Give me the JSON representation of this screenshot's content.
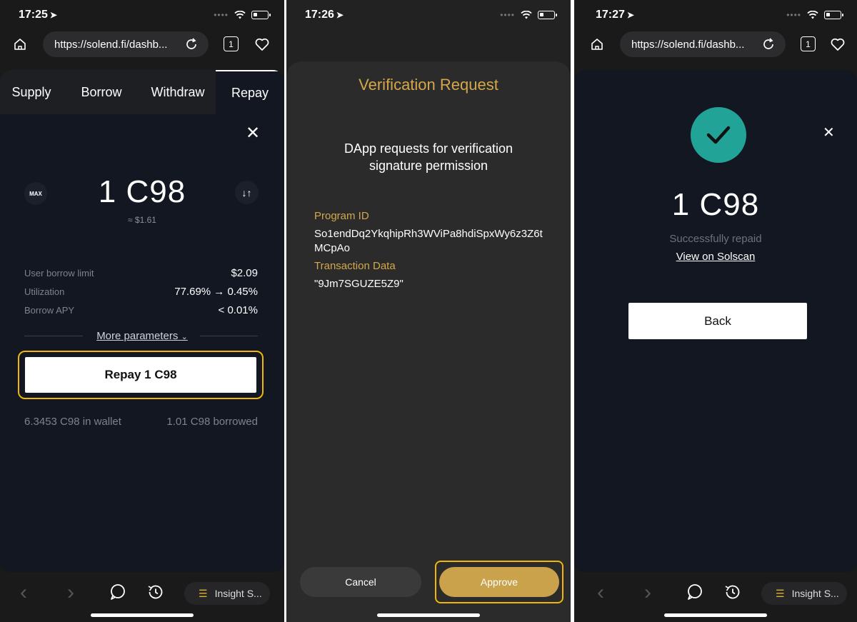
{
  "screen1": {
    "status": {
      "time": "17:25"
    },
    "browser": {
      "url": "https://solend.fi/dashb...",
      "tab_count": "1"
    },
    "tabs": [
      "Supply",
      "Borrow",
      "Withdraw",
      "Repay"
    ],
    "active_tab": "Repay",
    "max_label": "MAX",
    "amount": "1 C98",
    "usd_value": "≈ $1.61",
    "stats": [
      {
        "label": "User borrow limit",
        "value": "$2.09"
      },
      {
        "label": "Utilization",
        "value": "77.69% → 0.45%"
      },
      {
        "label": "Borrow APY",
        "value": "< 0.01%"
      }
    ],
    "more_parameters": "More parameters",
    "repay_button": "Repay 1 C98",
    "wallet_balance": "6.3453 C98 in wallet",
    "borrowed": "1.01 C98 borrowed",
    "insight_label": "Insight S..."
  },
  "screen2": {
    "status": {
      "time": "17:26"
    },
    "title": "Verification Request",
    "description": "DApp requests for verification signature permission",
    "program_id_label": "Program ID",
    "program_id_value": "So1endDq2YkqhipRh3WViPa8hdiSpxWy6z3Z6tMCpAo",
    "transaction_data_label": "Transaction Data",
    "transaction_data_value": "\"9Jm7SGUZE5Z9\"",
    "cancel_button": "Cancel",
    "approve_button": "Approve"
  },
  "screen3": {
    "status": {
      "time": "17:27"
    },
    "browser": {
      "url": "https://solend.fi/dashb...",
      "tab_count": "1"
    },
    "amount": "1 C98",
    "success_text": "Successfully repaid",
    "solscan_link": "View on Solscan",
    "back_button": "Back",
    "insight_label": "Insight S..."
  },
  "colors": {
    "highlight_border": "#f2b705",
    "gold_text": "#d4a84a",
    "approve_fill": "#caa24b",
    "success_teal": "#21a497",
    "card_bg": "#121722"
  },
  "icons": [
    "location-arrow-icon",
    "wifi-icon",
    "battery-icon",
    "home-icon",
    "reload-icon",
    "tabs-icon",
    "heart-icon",
    "close-icon",
    "swap-icon",
    "chevron-down-icon",
    "back-arrow-icon",
    "forward-arrow-icon",
    "chat-icon",
    "history-icon",
    "insight-icon",
    "checkmark-icon"
  ]
}
